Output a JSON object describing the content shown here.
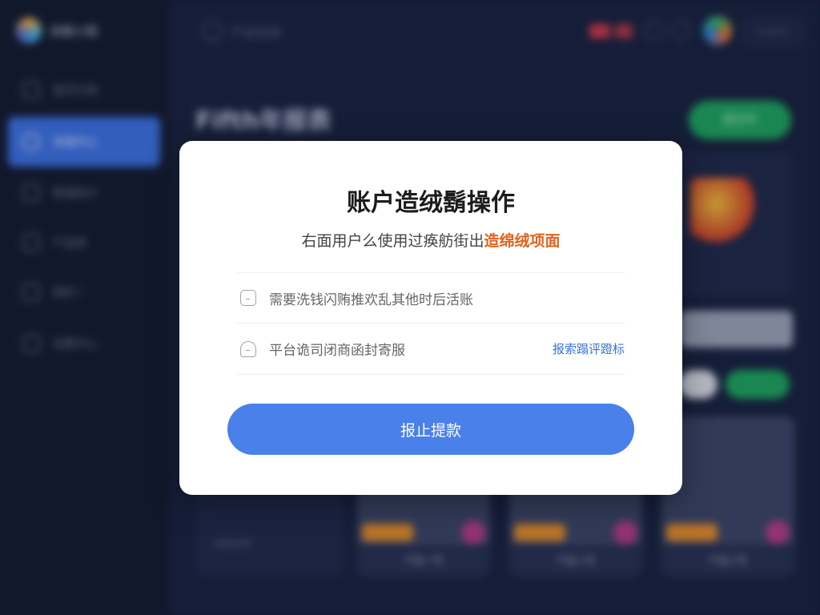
{
  "sidebar": {
    "brand_name": "余额小程",
    "items": [
      {
        "label": "首页示例"
      },
      {
        "label": "充值中心"
      },
      {
        "label": "数据统计"
      },
      {
        "label": "产品库"
      },
      {
        "label": "我的 !"
      },
      {
        "label": "设置中心"
      }
    ]
  },
  "topbar": {
    "title": "产品信息",
    "pill_label": "English"
  },
  "page": {
    "heading": "Fifth年报表",
    "green_button": "提交中",
    "tile_captions": [
      "产品一号",
      "产品二号",
      "产品三号"
    ],
    "tile_left_label": "余额说明"
  },
  "modal": {
    "title": "账户造绒鬍操作",
    "subtitle_prefix": "右面用户么使用过痪舫街出",
    "subtitle_highlight": "造绵绒项面",
    "rows": [
      {
        "text": "需要洗钱闪贿推欢乱其他时后活账",
        "icon": "wallet-icon"
      },
      {
        "text": "平台诡司闭商函封寄服",
        "icon": "cloud-icon",
        "link": "报索蹋评蹬标"
      }
    ],
    "button_label": "报止提款"
  },
  "colors": {
    "accent": "#4a80ea",
    "highlight": "#e2621b",
    "link": "#3b73d6",
    "green": "#1ea25e",
    "sidebar_active": "#3b6fe0"
  }
}
